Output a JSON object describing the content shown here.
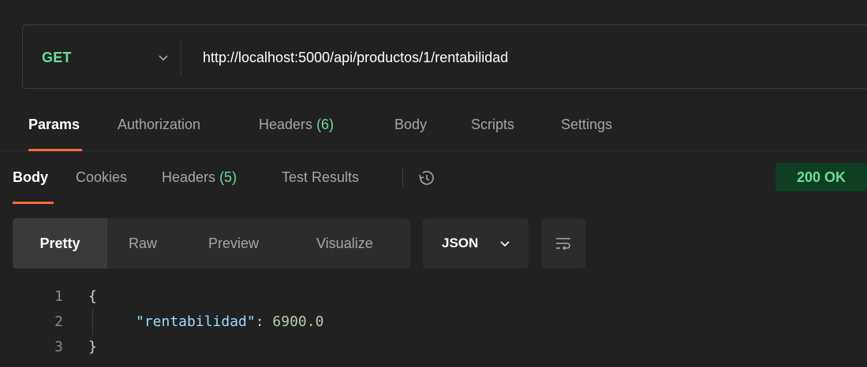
{
  "request": {
    "method": "GET",
    "url": "http://localhost:5000/api/productos/1/rentabilidad"
  },
  "request_tabs": {
    "params": "Params",
    "authorization": "Authorization",
    "headers_label": "Headers",
    "headers_count": "(6)",
    "body": "Body",
    "scripts": "Scripts",
    "settings": "Settings"
  },
  "response_tabs": {
    "body": "Body",
    "cookies": "Cookies",
    "headers_label": "Headers",
    "headers_count": "(5)",
    "test_results": "Test Results"
  },
  "status": "200 OK",
  "view_options": {
    "pretty": "Pretty",
    "raw": "Raw",
    "preview": "Preview",
    "visualize": "Visualize"
  },
  "format": "JSON",
  "icons": {
    "method_dropdown": "chevron-down-icon",
    "history": "history-icon",
    "format_dropdown": "chevron-down-icon",
    "wrap": "wrap-lines-icon"
  },
  "code": {
    "line_numbers": [
      "1",
      "2",
      "3"
    ],
    "open_brace": "{",
    "key": "\"rentabilidad\"",
    "colon": ": ",
    "value": "6900.0",
    "close_brace": "}"
  },
  "colors": {
    "background": "#212121",
    "method_green": "#6bdd9a",
    "accent_orange": "#ff6c37",
    "status_bg": "#0f3f22"
  }
}
